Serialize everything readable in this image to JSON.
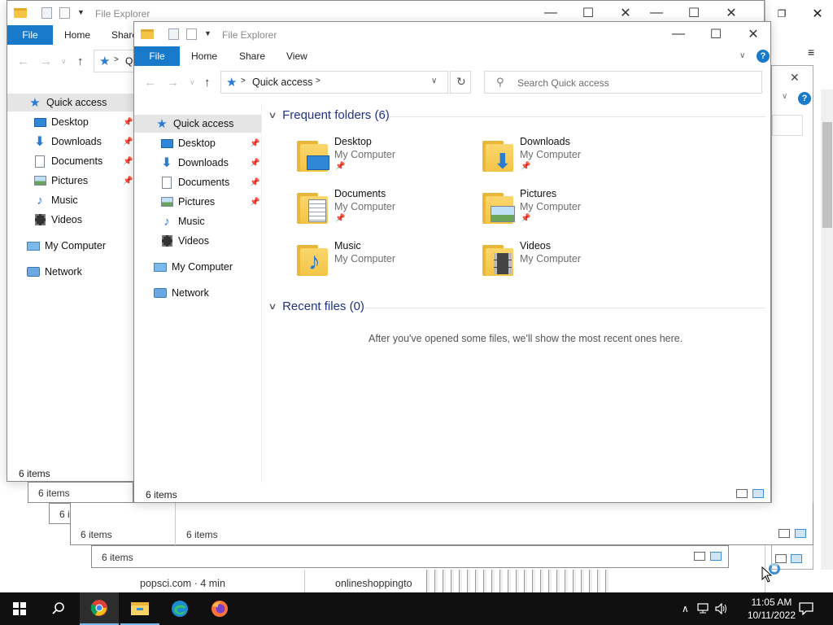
{
  "back_window": {
    "title": "File Explorer",
    "tabs": [
      "File",
      "Home",
      "Share"
    ],
    "address_fragment": "Q",
    "nav_items": [
      {
        "label": "Quick access",
        "icon": "star-icon",
        "selected": true
      },
      {
        "label": "Desktop",
        "icon": "desktop-folder-icon",
        "pinned": true
      },
      {
        "label": "Downloads",
        "icon": "downloads-folder-icon",
        "pinned": true
      },
      {
        "label": "Documents",
        "icon": "documents-folder-icon",
        "pinned": true
      },
      {
        "label": "Pictures",
        "icon": "pictures-folder-icon",
        "pinned": true
      },
      {
        "label": "Music",
        "icon": "music-folder-icon"
      },
      {
        "label": "Videos",
        "icon": "videos-folder-icon"
      },
      {
        "label": "My Computer",
        "icon": "computer-icon"
      },
      {
        "label": "Network",
        "icon": "network-icon"
      }
    ],
    "status": "6 items"
  },
  "stacked_status": [
    "6 items",
    "6 i",
    "6 items",
    "6 items",
    "6 items"
  ],
  "front_window": {
    "title": "File Explorer",
    "tabs": {
      "file": "File",
      "home": "Home",
      "share": "Share",
      "view": "View"
    },
    "address": "Quick access",
    "search_placeholder": "Search Quick access",
    "nav_items": [
      {
        "label": "Quick access",
        "icon": "star-icon",
        "selected": true
      },
      {
        "label": "Desktop",
        "icon": "desktop-folder-icon",
        "pinned": true
      },
      {
        "label": "Downloads",
        "icon": "downloads-folder-icon",
        "pinned": true
      },
      {
        "label": "Documents",
        "icon": "documents-folder-icon",
        "pinned": true
      },
      {
        "label": "Pictures",
        "icon": "pictures-folder-icon",
        "pinned": true
      },
      {
        "label": "Music",
        "icon": "music-folder-icon"
      },
      {
        "label": "Videos",
        "icon": "videos-folder-icon"
      },
      {
        "label": "My Computer",
        "icon": "computer-icon"
      },
      {
        "label": "Network",
        "icon": "network-icon"
      }
    ],
    "frequent_header": "Frequent folders (6)",
    "folders": [
      {
        "name": "Desktop",
        "location": "My Computer",
        "pinned": true
      },
      {
        "name": "Downloads",
        "location": "My Computer",
        "pinned": true
      },
      {
        "name": "Documents",
        "location": "My Computer",
        "pinned": true
      },
      {
        "name": "Pictures",
        "location": "My Computer",
        "pinned": true
      },
      {
        "name": "Music",
        "location": "My Computer",
        "pinned": false
      },
      {
        "name": "Videos",
        "location": "My Computer",
        "pinned": false
      }
    ],
    "recent_header": "Recent files (0)",
    "recent_empty": "After you've opened some files, we'll show the most recent ones here.",
    "status": "6 items"
  },
  "browser_strip": {
    "item1": "popsci.com · 4 min",
    "item2": "onlineshoppingto"
  },
  "taskbar": {
    "apps": [
      "chrome-icon",
      "file-explorer-icon",
      "edge-icon",
      "firefox-icon"
    ],
    "time": "11:05 AM",
    "date": "10/11/2022"
  },
  "colors": {
    "accent": "#1979ca",
    "group_header": "#1e3287",
    "taskbar": "#101010"
  }
}
